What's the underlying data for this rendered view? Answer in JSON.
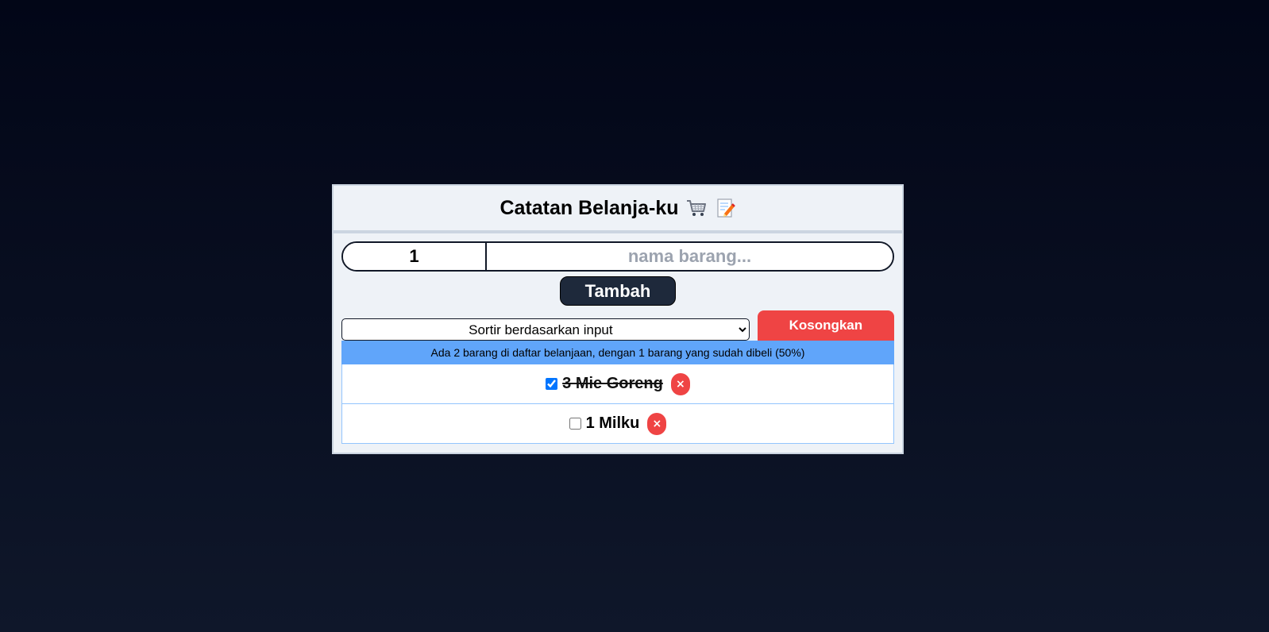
{
  "header": {
    "title": "Catatan Belanja-ku",
    "icons": [
      "shopping-cart-icon",
      "memo-icon"
    ]
  },
  "form": {
    "quantity_value": "1",
    "name_placeholder": "nama barang...",
    "add_button_label": "Tambah"
  },
  "controls": {
    "sort_selected": "Sortir berdasarkan input",
    "clear_button_label": "Kosongkan"
  },
  "info": {
    "text": "Ada 2 barang di daftar belanjaan, dengan 1 barang yang sudah dibeli (50%)"
  },
  "items": [
    {
      "label": "3 Mie Goreng",
      "checked": true,
      "delete_label": "×"
    },
    {
      "label": "1 Milku",
      "checked": false,
      "delete_label": "×"
    }
  ],
  "colors": {
    "background": "#0f172a",
    "panel": "#eef2f7",
    "primary_button": "#1e293b",
    "danger": "#ef4444",
    "info_bar": "#60a5fa"
  }
}
